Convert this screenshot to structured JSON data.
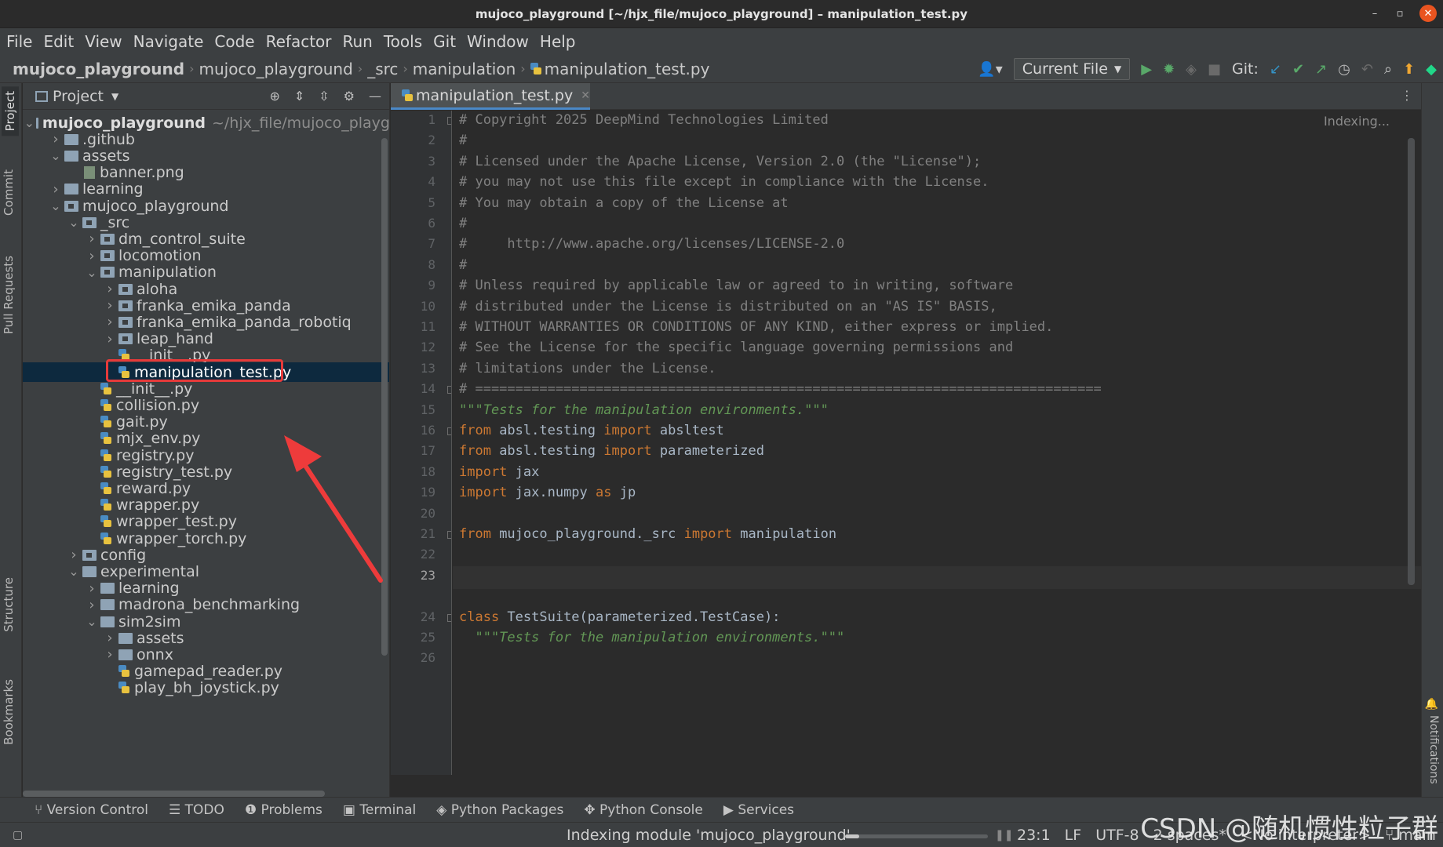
{
  "window": {
    "title": "mujoco_playground [~/hjx_file/mujoco_playground] – manipulation_test.py",
    "minimize": "–",
    "maximize": "▫",
    "close": "✕"
  },
  "menu": [
    "File",
    "Edit",
    "View",
    "Navigate",
    "Code",
    "Refactor",
    "Run",
    "Tools",
    "Git",
    "Window",
    "Help"
  ],
  "breadcrumb": {
    "root": "mujoco_playground",
    "items": [
      "mujoco_playground",
      "_src",
      "manipulation"
    ],
    "file": "manipulation_test.py"
  },
  "toolbar": {
    "run_config": "Current File",
    "git_label": "Git:"
  },
  "left_tabs": [
    "Project",
    "Commit",
    "Pull Requests",
    "Structure",
    "Bookmarks"
  ],
  "right_tabs": [
    "Notifications"
  ],
  "project": {
    "header": "Project",
    "tree": [
      {
        "label": "mujoco_playground",
        "suffix": "~/hjx_file/mujoco_playg",
        "depth": 0,
        "type": "folder",
        "open": true,
        "bold": true
      },
      {
        "label": ".github",
        "depth": 1,
        "type": "folder",
        "open": false
      },
      {
        "label": "assets",
        "depth": 1,
        "type": "folder",
        "open": true
      },
      {
        "label": "banner.png",
        "depth": 2,
        "type": "image"
      },
      {
        "label": "learning",
        "depth": 1,
        "type": "folder",
        "open": false
      },
      {
        "label": "mujoco_playground",
        "depth": 1,
        "type": "pkg",
        "open": true
      },
      {
        "label": "_src",
        "depth": 2,
        "type": "pkg",
        "open": true
      },
      {
        "label": "dm_control_suite",
        "depth": 3,
        "type": "pkg",
        "open": false
      },
      {
        "label": "locomotion",
        "depth": 3,
        "type": "pkg",
        "open": false
      },
      {
        "label": "manipulation",
        "depth": 3,
        "type": "pkg",
        "open": true
      },
      {
        "label": "aloha",
        "depth": 4,
        "type": "pkg",
        "open": false
      },
      {
        "label": "franka_emika_panda",
        "depth": 4,
        "type": "pkg",
        "open": false
      },
      {
        "label": "franka_emika_panda_robotiq",
        "depth": 4,
        "type": "pkg",
        "open": false
      },
      {
        "label": "leap_hand",
        "depth": 4,
        "type": "pkg",
        "open": false
      },
      {
        "label": "__init__.py",
        "depth": 4,
        "type": "py"
      },
      {
        "label": "manipulation_test.py",
        "depth": 4,
        "type": "py",
        "selected": true
      },
      {
        "label": "__init__.py",
        "depth": 3,
        "type": "py"
      },
      {
        "label": "collision.py",
        "depth": 3,
        "type": "py"
      },
      {
        "label": "gait.py",
        "depth": 3,
        "type": "py"
      },
      {
        "label": "mjx_env.py",
        "depth": 3,
        "type": "py"
      },
      {
        "label": "registry.py",
        "depth": 3,
        "type": "py"
      },
      {
        "label": "registry_test.py",
        "depth": 3,
        "type": "py"
      },
      {
        "label": "reward.py",
        "depth": 3,
        "type": "py"
      },
      {
        "label": "wrapper.py",
        "depth": 3,
        "type": "py"
      },
      {
        "label": "wrapper_test.py",
        "depth": 3,
        "type": "py"
      },
      {
        "label": "wrapper_torch.py",
        "depth": 3,
        "type": "py"
      },
      {
        "label": "config",
        "depth": 2,
        "type": "pkg",
        "open": false
      },
      {
        "label": "experimental",
        "depth": 2,
        "type": "folder",
        "open": true
      },
      {
        "label": "learning",
        "depth": 3,
        "type": "folder",
        "open": false
      },
      {
        "label": "madrona_benchmarking",
        "depth": 3,
        "type": "folder",
        "open": false
      },
      {
        "label": "sim2sim",
        "depth": 3,
        "type": "folder",
        "open": true
      },
      {
        "label": "assets",
        "depth": 4,
        "type": "folder",
        "open": false
      },
      {
        "label": "onnx",
        "depth": 4,
        "type": "folder",
        "open": false
      },
      {
        "label": "gamepad_reader.py",
        "depth": 4,
        "type": "py"
      },
      {
        "label": "play_bh_joystick.py",
        "depth": 4,
        "type": "py"
      }
    ]
  },
  "editor": {
    "tab": "manipulation_test.py",
    "status": "Indexing...",
    "current_line": 23,
    "lines": [
      {
        "n": "1",
        "parts": [
          [
            "c-com",
            "# Copyright 2025 DeepMind Technologies Limited"
          ]
        ],
        "fold": true
      },
      {
        "n": "2",
        "parts": [
          [
            "c-com",
            "#"
          ]
        ]
      },
      {
        "n": "3",
        "parts": [
          [
            "c-com",
            "# Licensed under the Apache License, Version 2.0 (the \"License\");"
          ]
        ]
      },
      {
        "n": "4",
        "parts": [
          [
            "c-com",
            "# you may not use this file except in compliance with the License."
          ]
        ]
      },
      {
        "n": "5",
        "parts": [
          [
            "c-com",
            "# You may obtain a copy of the License at"
          ]
        ]
      },
      {
        "n": "6",
        "parts": [
          [
            "c-com",
            "#"
          ]
        ]
      },
      {
        "n": "7",
        "parts": [
          [
            "c-com",
            "#     http://www.apache.org/licenses/LICENSE-2.0"
          ]
        ]
      },
      {
        "n": "8",
        "parts": [
          [
            "c-com",
            "#"
          ]
        ]
      },
      {
        "n": "9",
        "parts": [
          [
            "c-com",
            "# Unless required by applicable law or agreed to in writing, software"
          ]
        ]
      },
      {
        "n": "10",
        "parts": [
          [
            "c-com",
            "# distributed under the License is distributed on an \"AS IS\" BASIS,"
          ]
        ]
      },
      {
        "n": "11",
        "parts": [
          [
            "c-com",
            "# WITHOUT WARRANTIES OR CONDITIONS OF ANY KIND, either express or implied."
          ]
        ]
      },
      {
        "n": "12",
        "parts": [
          [
            "c-com",
            "# See the License for the specific language governing permissions and"
          ]
        ]
      },
      {
        "n": "13",
        "parts": [
          [
            "c-com",
            "# limitations under the License."
          ]
        ]
      },
      {
        "n": "14",
        "parts": [
          [
            "c-com",
            "# =============================================================================="
          ]
        ],
        "fold": true
      },
      {
        "n": "15",
        "parts": [
          [
            "c-doc",
            "\"\"\"Tests for the manipulation environments.\"\"\""
          ]
        ]
      },
      {
        "n": "16",
        "parts": [
          [
            "c-kw",
            "from"
          ],
          [
            "",
            " absl.testing "
          ],
          [
            "c-kw",
            "import"
          ],
          [
            "",
            " absltest"
          ]
        ],
        "fold": true
      },
      {
        "n": "17",
        "parts": [
          [
            "c-kw",
            "from"
          ],
          [
            "",
            " absl.testing "
          ],
          [
            "c-kw",
            "import"
          ],
          [
            "",
            " parameterized"
          ]
        ]
      },
      {
        "n": "18",
        "parts": [
          [
            "c-kw",
            "import"
          ],
          [
            "",
            " jax"
          ]
        ]
      },
      {
        "n": "19",
        "parts": [
          [
            "c-kw",
            "import"
          ],
          [
            "",
            " jax.numpy "
          ],
          [
            "c-kw",
            "as"
          ],
          [
            "",
            " jp"
          ]
        ]
      },
      {
        "n": "20",
        "parts": []
      },
      {
        "n": "21",
        "parts": [
          [
            "c-kw",
            "from"
          ],
          [
            "",
            " mujoco_playground._src "
          ],
          [
            "c-kw",
            "import"
          ],
          [
            "",
            " manipulation"
          ]
        ],
        "fold": true
      },
      {
        "n": "22",
        "parts": []
      },
      {
        "n": "23",
        "parts": [],
        "current": true
      },
      {
        "n": "",
        "parts": []
      },
      {
        "n": "24",
        "parts": [
          [
            "c-kw",
            "class"
          ],
          [
            "",
            " TestSuite(parameterized.TestCase):"
          ]
        ],
        "fold": true
      },
      {
        "n": "25",
        "parts": [
          [
            "c-doc",
            "  \"\"\"Tests for the manipulation environments.\"\"\""
          ]
        ]
      },
      {
        "n": "26",
        "parts": []
      }
    ]
  },
  "bottom_tools": [
    "Version Control",
    "TODO",
    "Problems",
    "Terminal",
    "Python Packages",
    "Python Console",
    "Services"
  ],
  "statusbar": {
    "indexing": "Indexing module 'mujoco_playground'",
    "progress": 0.1,
    "position": "23:1",
    "line_sep": "LF",
    "encoding": "UTF-8",
    "indent": "2 spaces*",
    "interpreter": "<No interpreter>",
    "branch": "main"
  },
  "watermark": "CSDN @随机惯性粒子群"
}
